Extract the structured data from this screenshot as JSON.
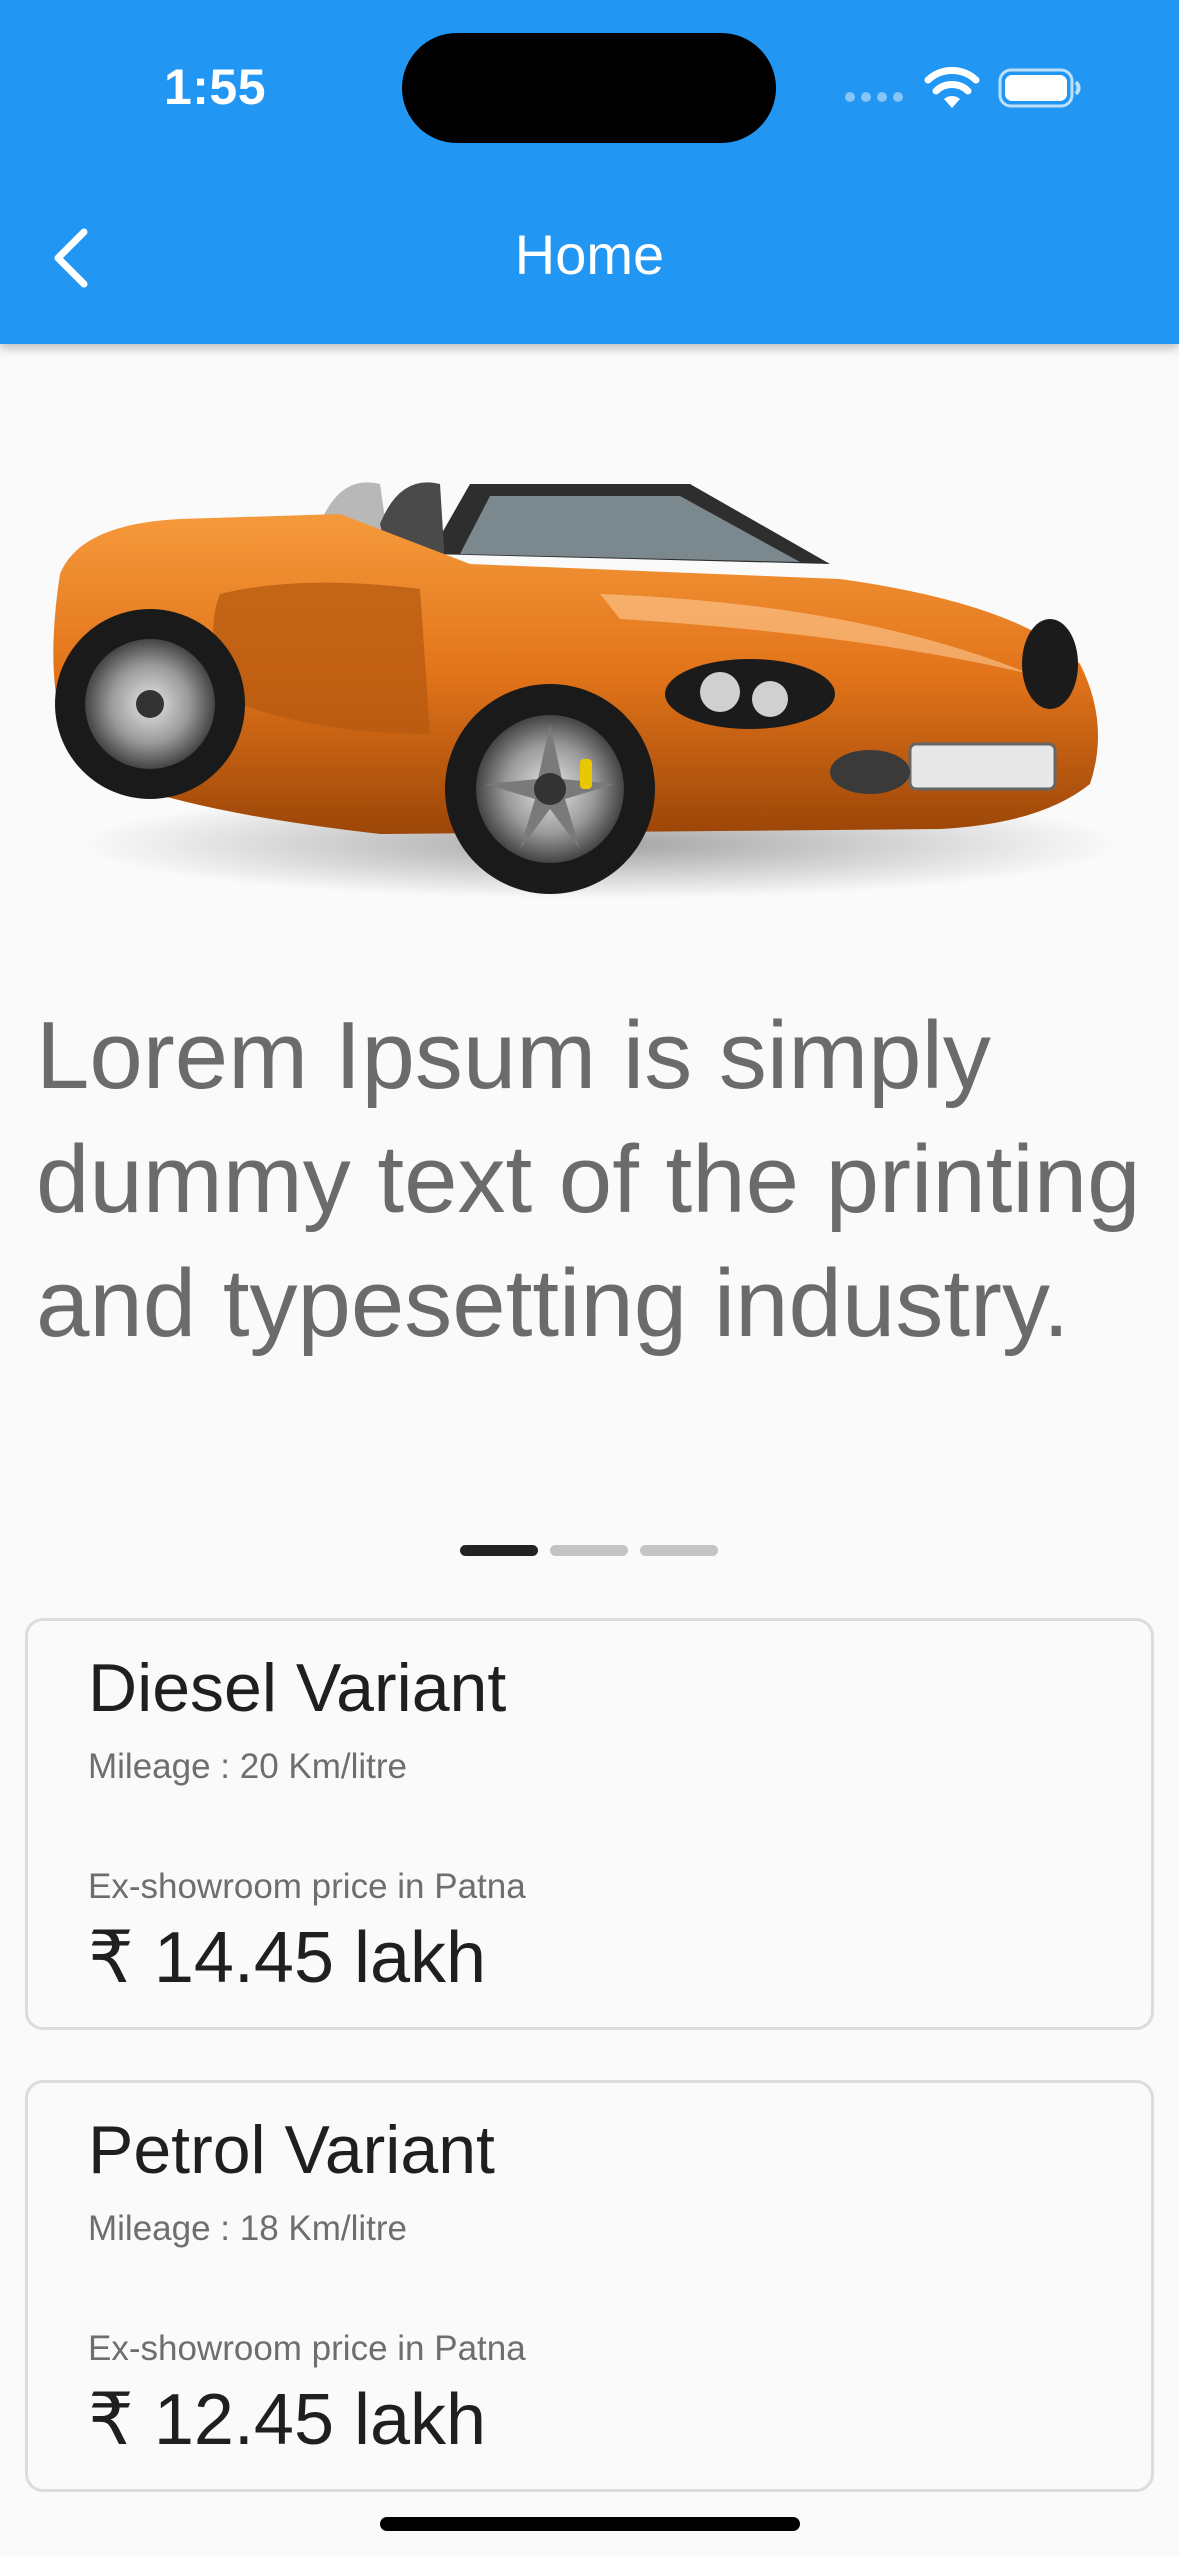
{
  "status_bar": {
    "time": "1:55"
  },
  "header": {
    "title": "Home"
  },
  "carousel": {
    "text": "Lorem Ipsum is simply dummy text of the printing and typesetting industry.",
    "active_index": 0,
    "page_count": 3
  },
  "variants": [
    {
      "title": "Diesel Variant",
      "mileage": "Mileage : 20 Km/litre",
      "price_label": "Ex-showroom price in Patna",
      "price": "₹ 14.45 lakh"
    },
    {
      "title": "Petrol Variant",
      "mileage": "Mileage : 18 Km/litre",
      "price_label": "Ex-showroom price in Patna",
      "price": "₹ 12.45 lakh"
    }
  ],
  "colors": {
    "app_bar": "#2196f3",
    "car": "#e2741a"
  }
}
